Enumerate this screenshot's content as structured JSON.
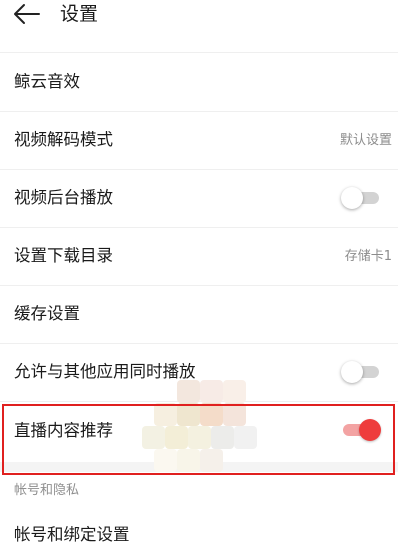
{
  "header": {
    "title": "设置"
  },
  "rows": [
    {
      "label": "鲸云音效"
    },
    {
      "label": "视频解码模式",
      "value": "默认设置"
    },
    {
      "label": "视频后台播放",
      "toggle": false
    },
    {
      "label": "设置下载目录",
      "value": "存储卡1"
    },
    {
      "label": "缓存设置"
    },
    {
      "label": "允许与其他应用同时播放",
      "toggle": false
    },
    {
      "label": "直播内容推荐",
      "toggle": true
    }
  ],
  "section": {
    "label": "帐号和隐私"
  },
  "account_row": {
    "label": "帐号和绑定设置"
  },
  "colors": {
    "accent": "#ee3c3c",
    "highlight_border": "#e0201f"
  }
}
